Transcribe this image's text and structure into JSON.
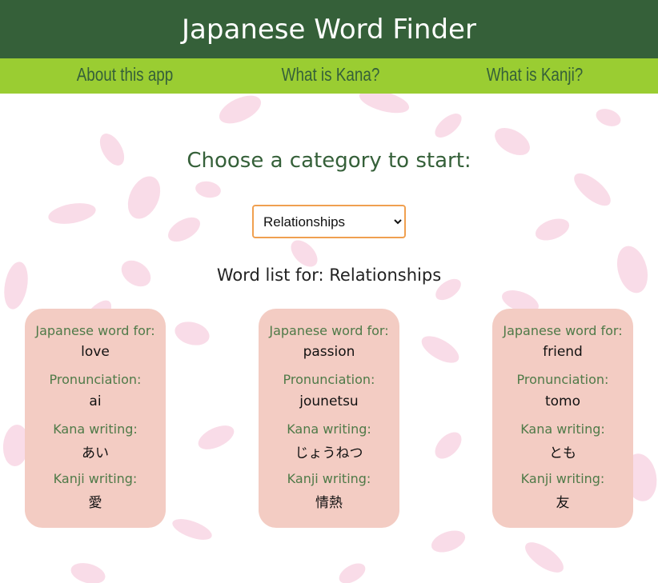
{
  "header": {
    "title": "Japanese Word Finder"
  },
  "nav": [
    {
      "label": "About this app"
    },
    {
      "label": "What is Kana?"
    },
    {
      "label": "What is Kanji?"
    }
  ],
  "main": {
    "prompt": "Choose a category to start:",
    "category_select": {
      "selected": "Relationships"
    },
    "list_title": "Word list for: Relationships"
  },
  "labels": {
    "word_for": "Japanese word for:",
    "pronunciation": "Pronunciation:",
    "kana": "Kana writing:",
    "kanji": "Kanji writing:"
  },
  "words": [
    {
      "english": "love",
      "pronunciation": "ai",
      "kana": "あい",
      "kanji": "愛"
    },
    {
      "english": "passion",
      "pronunciation": "jounetsu",
      "kana": "じょうねつ",
      "kanji": "情熱"
    },
    {
      "english": "friend",
      "pronunciation": "tomo",
      "kana": "とも",
      "kanji": "友"
    }
  ],
  "colors": {
    "header_bg": "#356039",
    "nav_bg": "#9acd32",
    "card_bg": "#f3ccc3",
    "accent_text": "#356039",
    "select_border": "#f0a050",
    "petal": "#f8d6e4"
  },
  "icons": {
    "background": "cherry-blossom-petals"
  }
}
